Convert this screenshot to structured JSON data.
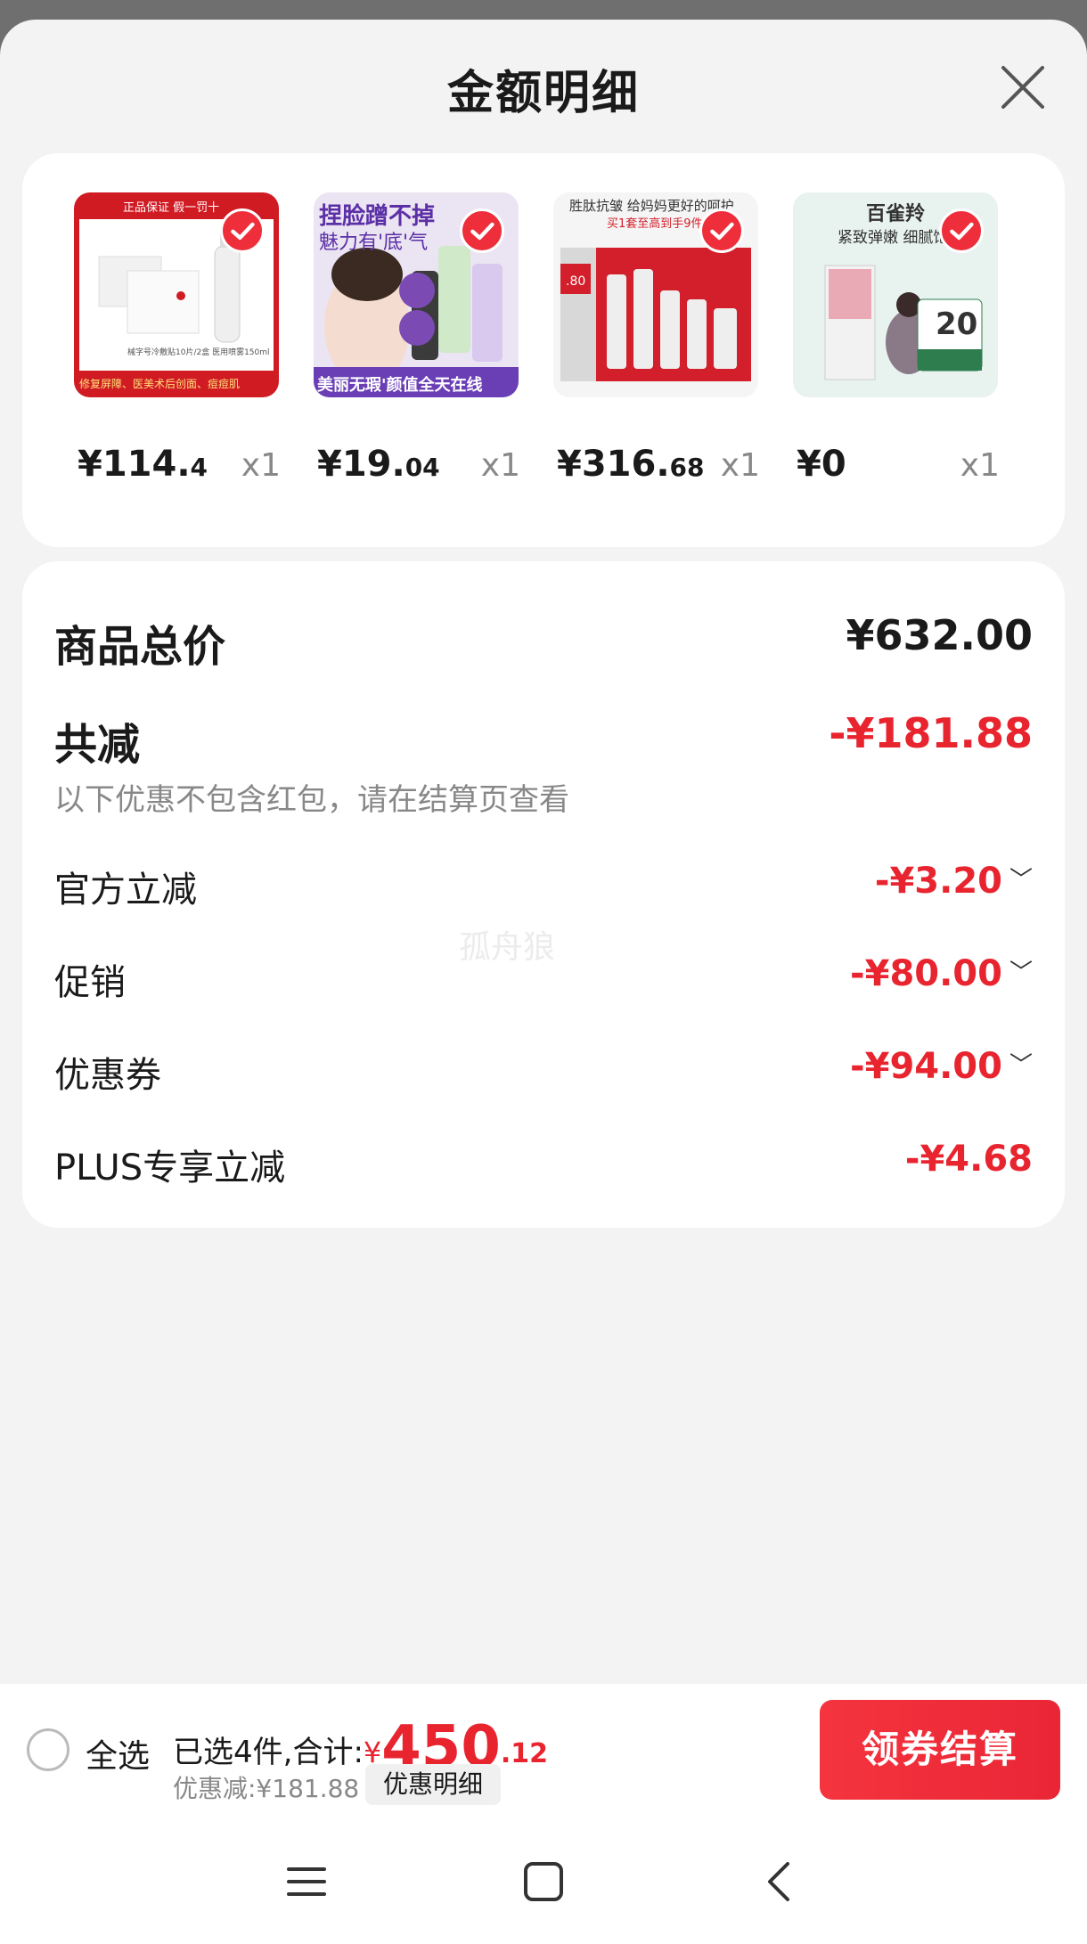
{
  "sheet": {
    "title": "金额明细"
  },
  "products": [
    {
      "price_int": "¥114.",
      "price_dec": "4",
      "qty": "x1",
      "image": "medical-skincare-set-image"
    },
    {
      "price_int": "¥19.",
      "price_dec": "04",
      "qty": "x1",
      "image": "foundation-primer-image"
    },
    {
      "price_int": "¥316.",
      "price_dec": "68",
      "qty": "x1",
      "image": "red-skincare-giftbox-image"
    },
    {
      "price_int": "¥0",
      "price_dec": "",
      "qty": "x1",
      "image": "face-mask-sheet-image"
    }
  ],
  "product_image_text": {
    "p1_banner": "正品保证 假一罚十",
    "p1_footer": "修复屏障、医美术后创面、痘痘肌",
    "p2_title1": "捏脸蹭不掉",
    "p2_title2": "魅力有'底'气",
    "p2_footer": "美丽无瑕'颜值全天在线",
    "p3_title": "胜肽抗皱 给妈妈更好的呵护",
    "p3_sub": "买1套至高到手9件",
    "p4_brand": "百雀羚",
    "p4_title": "紧致弹嫩 细腻饱满",
    "p4_badge": "20"
  },
  "summary": {
    "total_label": "商品总价",
    "total_value": "¥632.00",
    "reduce_label": "共减",
    "reduce_value": "-¥181.88",
    "note": "以下优惠不包含红包，请在结算页查看",
    "items": [
      {
        "label": "官方立减",
        "value": "-¥3.20",
        "expandable": true
      },
      {
        "label": "促销",
        "value": "-¥80.00",
        "expandable": true
      },
      {
        "label": "优惠券",
        "value": "-¥94.00",
        "expandable": true
      },
      {
        "label": "PLUS专享立减",
        "value": "-¥4.68",
        "expandable": false
      }
    ]
  },
  "watermark": "孤舟狼",
  "bottom_bar": {
    "select_all": "全选",
    "selected_text": "已选4件,合计:",
    "currency": "¥",
    "total_int": "450",
    "total_dec": ".12",
    "discount_text": "优惠减:¥181.88",
    "detail_label": "优惠明细",
    "checkout_label": "领券结算"
  },
  "colors": {
    "accent_red": "#e8242f",
    "check_red": "#ee2e3a"
  },
  "nav": {
    "icons": [
      "menu-icon",
      "home-icon",
      "back-icon"
    ]
  }
}
